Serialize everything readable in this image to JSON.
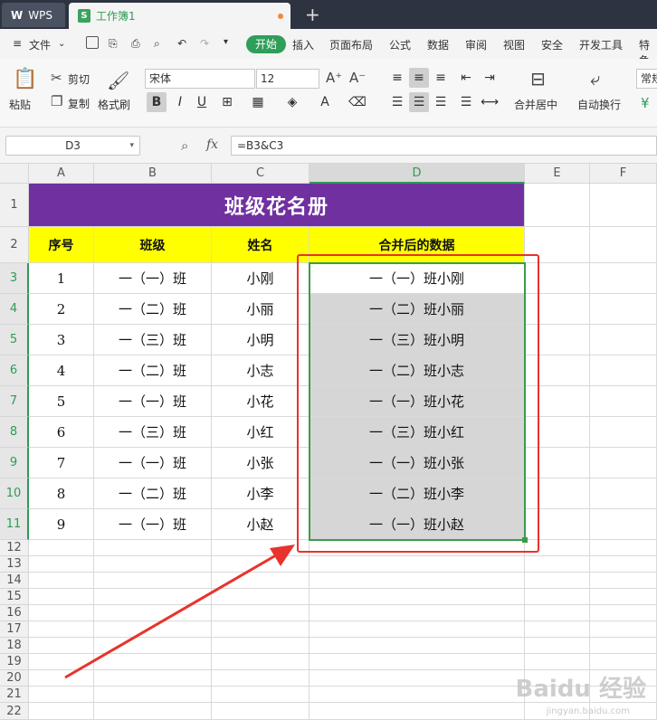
{
  "titlebar": {
    "app_tab": "WPS",
    "doc_tab": "工作簿1",
    "doc_icon": "S"
  },
  "menu": {
    "file": "文件",
    "items": [
      "开始",
      "插入",
      "页面布局",
      "公式",
      "数据",
      "审阅",
      "视图",
      "安全",
      "开发工具",
      "特色"
    ]
  },
  "ribbon": {
    "paste": "粘贴",
    "cut": "剪切",
    "copy": "复制",
    "format_painter": "格式刷",
    "font_name": "宋体",
    "font_size": "12",
    "merge_center": "合并居中",
    "wrap_text": "自动换行",
    "number_format": "常规"
  },
  "formula_bar": {
    "cell_ref": "D3",
    "fx": "fx",
    "formula": "=B3&C3"
  },
  "columns": [
    "A",
    "B",
    "C",
    "D",
    "E",
    "F"
  ],
  "rows": [
    "1",
    "2",
    "3",
    "4",
    "5",
    "6",
    "7",
    "8",
    "9",
    "10",
    "11",
    "12",
    "13",
    "14",
    "15",
    "16",
    "17",
    "18",
    "19",
    "20",
    "21",
    "22"
  ],
  "sheet": {
    "title": "班级花名册",
    "headers": [
      "序号",
      "班级",
      "姓名",
      "合并后的数据"
    ],
    "data": [
      [
        "1",
        "一（一）班",
        "小刚",
        "一（一）班小刚"
      ],
      [
        "2",
        "一（二）班",
        "小丽",
        "一（二）班小丽"
      ],
      [
        "3",
        "一（三）班",
        "小明",
        "一（三）班小明"
      ],
      [
        "4",
        "一（二）班",
        "小志",
        "一（二）班小志"
      ],
      [
        "5",
        "一（一）班",
        "小花",
        "一（一）班小花"
      ],
      [
        "6",
        "一（三）班",
        "小红",
        "一（三）班小红"
      ],
      [
        "7",
        "一（一）班",
        "小张",
        "一（一）班小张"
      ],
      [
        "8",
        "一（二）班",
        "小李",
        "一（二）班小李"
      ],
      [
        "9",
        "一（一）班",
        "小赵",
        "一（一）班小赵"
      ]
    ]
  },
  "colors": {
    "title_bg": "#7030a0",
    "header_bg": "#ffff00",
    "accent": "#2f9e59",
    "annotation": "#e8332c"
  },
  "watermark": {
    "brand": "Baidu 经验",
    "url": "jingyan.baidu.com"
  }
}
